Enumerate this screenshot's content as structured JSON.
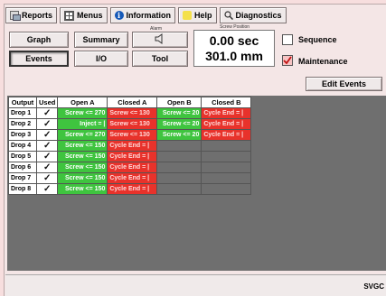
{
  "menubar": {
    "reports": "Reports",
    "menus": "Menus",
    "information": "Information",
    "help": "Help",
    "diagnostics": "Diagnostics"
  },
  "panel": {
    "graph": "Graph",
    "summary": "Summary",
    "events": "Events",
    "io": "I/O",
    "tool": "Tool",
    "alarm_label": "Alarm",
    "screw_position_label": "Screw Position",
    "time_value": "0.00 sec",
    "position_value": "301.0 mm",
    "sequence": "Sequence",
    "maintenance": "Maintenance",
    "edit_events": "Edit Events"
  },
  "table": {
    "headers": [
      "Output",
      "Used",
      "Open A",
      "Closed A",
      "Open B",
      "Closed B"
    ],
    "rows": [
      {
        "output": "Drop 1",
        "used": "✓",
        "open_a": "Screw <= 270",
        "closed_a": "Screw <= 130",
        "open_b": "Screw <= 20",
        "closed_b": "Cycle End = |"
      },
      {
        "output": "Drop 2",
        "used": "✓",
        "open_a": "Inject = |",
        "closed_a": "Screw <= 130",
        "open_b": "Screw <= 20",
        "closed_b": "Cycle End = |"
      },
      {
        "output": "Drop 3",
        "used": "✓",
        "open_a": "Screw <= 270",
        "closed_a": "Screw <= 130",
        "open_b": "Screw <= 20",
        "closed_b": "Cycle End = |"
      },
      {
        "output": "Drop 4",
        "used": "✓",
        "open_a": "Screw <= 150",
        "closed_a": "Cycle End = |",
        "open_b": "",
        "closed_b": ""
      },
      {
        "output": "Drop 5",
        "used": "✓",
        "open_a": "Screw <= 150",
        "closed_a": "Cycle End = |",
        "open_b": "",
        "closed_b": ""
      },
      {
        "output": "Drop 6",
        "used": "✓",
        "open_a": "Screw <= 150",
        "closed_a": "Cycle End = |",
        "open_b": "",
        "closed_b": ""
      },
      {
        "output": "Drop 7",
        "used": "✓",
        "open_a": "Screw <= 150",
        "closed_a": "Cycle End = |",
        "open_b": "",
        "closed_b": ""
      },
      {
        "output": "Drop 8",
        "used": "✓",
        "open_a": "Screw <= 150",
        "closed_a": "Cycle End = |",
        "open_b": "",
        "closed_b": ""
      }
    ]
  },
  "status": {
    "text": "SVGC"
  },
  "icons": {
    "reports": "report-icon",
    "menus": "grid-menu-icon",
    "information": "info-icon",
    "help": "help-icon",
    "diagnostics": "diagnostics-icon",
    "alarm": "speaker-icon"
  },
  "colors": {
    "open_cell": "#3fc43f",
    "closed_cell": "#e8322b",
    "background": "#f4e6e6"
  }
}
